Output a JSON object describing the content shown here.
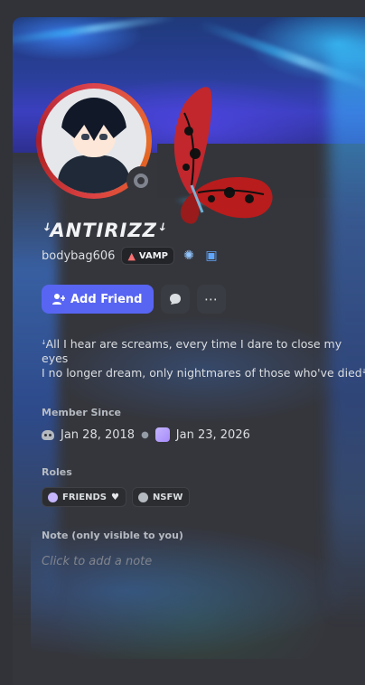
{
  "profile": {
    "display_name": "ꜜANTIRIZZꜜ",
    "username": "bodybag606",
    "tag_label": "VAMP",
    "tag_icon": "blood-drop-icon",
    "badges": [
      "nitro-boost-icon",
      "gift-icon"
    ]
  },
  "actions": {
    "add_friend_label": "Add Friend",
    "message_icon": "chat-bubble-icon",
    "more_icon": "more-icon",
    "more_glyph": "⋯"
  },
  "bio": {
    "lines": [
      "ꜜAll I hear are screams, every time I dare to close my",
      "eyes",
      "I no longer dream, only nightmares of those who've diedꜜ"
    ]
  },
  "member_since": {
    "title": "Member Since",
    "discord_date": "Jan 28, 2018",
    "server_date": "Jan 23, 2026"
  },
  "roles": {
    "title": "Roles",
    "items": [
      {
        "label": "FRIENDS",
        "color": "#c4b5fd",
        "suffix": "♥"
      },
      {
        "label": "NSFW",
        "color": "#b5bac1",
        "suffix": ""
      }
    ]
  },
  "note": {
    "title": "Note (only visible to you)",
    "placeholder": "Click to add a note"
  },
  "colors": {
    "background": "#313338",
    "accent": "#5865f2",
    "status_offline": "#80848e"
  }
}
